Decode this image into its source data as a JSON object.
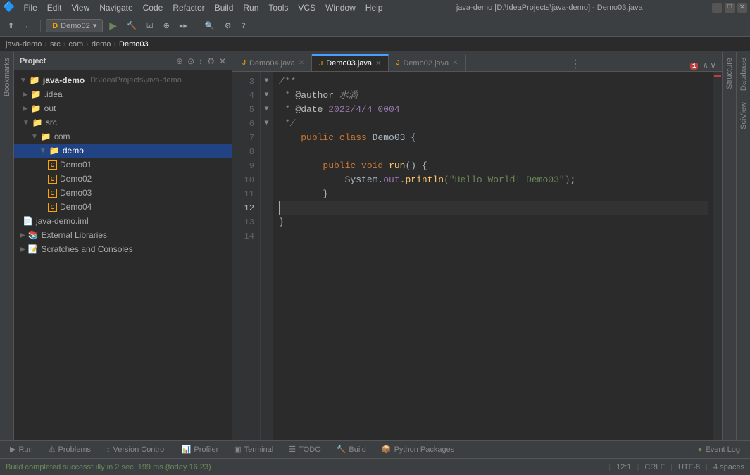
{
  "window": {
    "title": "java-demo [D:\\IdeaProjects\\java-demo] - Demo03.java",
    "min": "−",
    "max": "□",
    "close": "✕"
  },
  "menubar": {
    "items": [
      "File",
      "Edit",
      "View",
      "Navigate",
      "Code",
      "Refactor",
      "Build",
      "Run",
      "Tools",
      "VCS",
      "Window",
      "Help"
    ]
  },
  "toolbar": {
    "run_config": "Demo02",
    "run_icon": "▶",
    "debug_icon": "🐛",
    "search_icon": "🔍",
    "settings_icon": "⚙"
  },
  "breadcrumb": {
    "parts": [
      "java-demo",
      "src",
      "com",
      "demo",
      "Demo03"
    ]
  },
  "project": {
    "title": "Project",
    "tree": [
      {
        "label": "java-demo  D:\\IdeaProjects\\java-demo",
        "level": 0,
        "icon": "project",
        "expanded": true
      },
      {
        "label": ".idea",
        "level": 1,
        "icon": "folder",
        "expanded": false
      },
      {
        "label": "out",
        "level": 1,
        "icon": "folder-yellow",
        "expanded": false
      },
      {
        "label": "src",
        "level": 1,
        "icon": "folder",
        "expanded": true
      },
      {
        "label": "com",
        "level": 2,
        "icon": "folder",
        "expanded": true
      },
      {
        "label": "demo",
        "level": 3,
        "icon": "folder",
        "expanded": true,
        "selected": true
      },
      {
        "label": "Demo01",
        "level": 4,
        "icon": "class"
      },
      {
        "label": "Demo02",
        "level": 4,
        "icon": "class"
      },
      {
        "label": "Demo03",
        "level": 4,
        "icon": "class"
      },
      {
        "label": "Demo04",
        "level": 4,
        "icon": "class"
      },
      {
        "label": "java-demo.iml",
        "level": 1,
        "icon": "iml"
      },
      {
        "label": "External Libraries",
        "level": 0,
        "icon": "folder",
        "expanded": false
      },
      {
        "label": "Scratches and Consoles",
        "level": 0,
        "icon": "folder",
        "expanded": false
      }
    ]
  },
  "tabs": [
    {
      "label": "Demo04.java",
      "active": false,
      "icon": "J"
    },
    {
      "label": "Demo03.java",
      "active": true,
      "icon": "J"
    },
    {
      "label": "Demo02.java",
      "active": false,
      "icon": "J"
    }
  ],
  "code": {
    "lines": [
      {
        "num": "3",
        "gutter": "▼",
        "content": [
          {
            "type": "comment",
            "text": "/**"
          }
        ]
      },
      {
        "num": "4",
        "gutter": "",
        "content": [
          {
            "type": "comment",
            "text": " * "
          },
          {
            "type": "annotation",
            "text": "@author"
          },
          {
            "type": "comment",
            "text": " 水满"
          }
        ]
      },
      {
        "num": "5",
        "gutter": "",
        "content": [
          {
            "type": "comment",
            "text": " * "
          },
          {
            "type": "annotation",
            "text": "@date"
          },
          {
            "type": "annotation-text",
            "text": " 2022/4/4 0004"
          }
        ]
      },
      {
        "num": "6",
        "gutter": "▼",
        "content": [
          {
            "type": "comment",
            "text": " */"
          }
        ]
      },
      {
        "num": "7",
        "gutter": "",
        "content": [
          {
            "type": "plain",
            "text": "    "
          },
          {
            "type": "kw",
            "text": "public class"
          },
          {
            "type": "plain",
            "text": " Demo03 {"
          }
        ]
      },
      {
        "num": "8",
        "gutter": "",
        "content": []
      },
      {
        "num": "9",
        "gutter": "▼",
        "content": [
          {
            "type": "plain",
            "text": "        "
          },
          {
            "type": "kw",
            "text": "public void"
          },
          {
            "type": "plain",
            "text": " "
          },
          {
            "type": "method",
            "text": "run"
          },
          {
            "type": "plain",
            "text": "() {"
          }
        ]
      },
      {
        "num": "10",
        "gutter": "",
        "content": [
          {
            "type": "plain",
            "text": "            System."
          },
          {
            "type": "plain",
            "text": "out"
          },
          {
            "type": "plain",
            "text": "."
          },
          {
            "type": "method",
            "text": "println"
          },
          {
            "type": "str",
            "text": "(\"Hello World! Demo03\")"
          },
          {
            "type": "plain",
            "text": ";"
          }
        ]
      },
      {
        "num": "11",
        "gutter": "▼",
        "content": [
          {
            "type": "plain",
            "text": "        }"
          }
        ]
      },
      {
        "num": "12",
        "gutter": "",
        "content": [],
        "cursor": true
      },
      {
        "num": "13",
        "gutter": "",
        "content": [
          {
            "type": "plain",
            "text": "}"
          }
        ]
      },
      {
        "num": "14",
        "gutter": "",
        "content": []
      }
    ]
  },
  "statusbar": {
    "message": "Build completed successfully in 2 sec, 199 ms (today 16:23)",
    "position": "12:1",
    "line_ending": "CRLF",
    "encoding": "UTF-8",
    "indent": "4 spaces",
    "alerts": "1"
  },
  "bottombar": {
    "tabs": [
      {
        "label": "Run",
        "icon": "▶"
      },
      {
        "label": "Problems",
        "icon": "⚠"
      },
      {
        "label": "Version Control",
        "icon": "↕"
      },
      {
        "label": "Profiler",
        "icon": "📊"
      },
      {
        "label": "Terminal",
        "icon": "▣"
      },
      {
        "label": "TODO",
        "icon": "☰"
      },
      {
        "label": "Build",
        "icon": "🔨"
      },
      {
        "label": "Python Packages",
        "icon": "📦"
      }
    ],
    "event_log": "Event Log"
  },
  "side_panels": {
    "structure": "Structure",
    "database": "Database",
    "scview": "SciView",
    "bookmarks": "Bookmarks"
  }
}
